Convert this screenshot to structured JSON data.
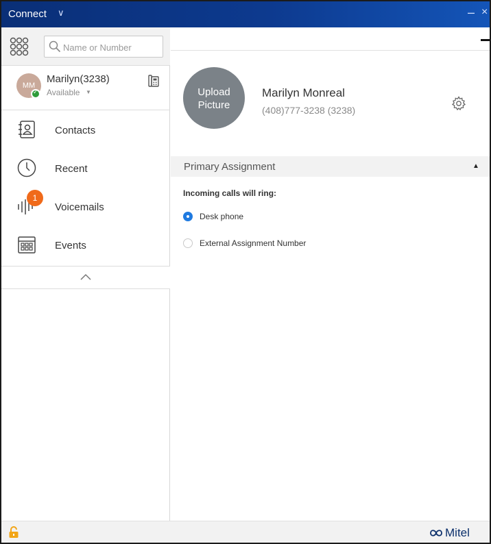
{
  "titlebar": {
    "app_title": "Connect",
    "chevron": "∨",
    "minimize": "–",
    "close": "×"
  },
  "search": {
    "placeholder": "Name or Number"
  },
  "user": {
    "initials": "MM",
    "name": "Marilyn(3238)",
    "status": "Available"
  },
  "nav": [
    {
      "label": "Contacts",
      "icon": "contacts-icon"
    },
    {
      "label": "Recent",
      "icon": "clock-icon"
    },
    {
      "label": "Voicemails",
      "icon": "voicemail-icon",
      "badge": "1"
    },
    {
      "label": "Events",
      "icon": "calendar-icon"
    }
  ],
  "profile": {
    "upload_label_line1": "Upload",
    "upload_label_line2": "Picture",
    "full_name": "Marilyn Monreal",
    "number": "(408)777-3238 (3238)"
  },
  "assignment": {
    "section_title": "Primary Assignment",
    "ring_label": "Incoming calls will ring:",
    "options": [
      {
        "label": "Desk phone",
        "selected": true
      },
      {
        "label": "External Assignment Number",
        "selected": false
      }
    ]
  },
  "footer": {
    "brand": "Mitel"
  },
  "colors": {
    "titlebar": "#0d3a8f",
    "accent": "#1f7ae0",
    "badge": "#f06a1a",
    "available": "#2e9c3a",
    "lock": "#f2a516",
    "brand": "#0b2f6b"
  }
}
